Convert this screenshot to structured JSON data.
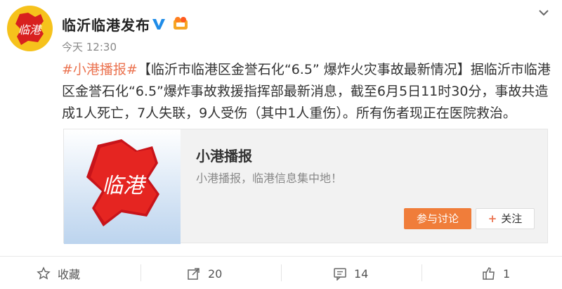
{
  "user": {
    "name": "临沂临港发布",
    "time": "今天 12:30",
    "avatar_text": "临港"
  },
  "post": {
    "hashtag": "#小港播报#",
    "body": "【临沂市临港区金誉石化“6.5” 爆炸火灾事故最新情况】据临沂市临港区金誉石化“6.5”爆炸事故救援指挥部最新消息，截至6月5日11时30分，事故共造成1人死亡，7人失联，9人受伤（其中1人重伤）。所有伤者现正在医院救治。"
  },
  "card": {
    "title": "小港播报",
    "description": "小港播报，临港信息集中地！",
    "discuss_label": "参与讨论",
    "follow_label": "关注",
    "image_text": "临港"
  },
  "actions": {
    "favorite_label": "收藏",
    "repost_count": "20",
    "comment_count": "14",
    "like_count": "1"
  },
  "colors": {
    "accent": "#eb7350",
    "discuss_button": "#f07d3a",
    "verified": "#1f8ce8",
    "avatar_bg": "#f6c21c"
  }
}
